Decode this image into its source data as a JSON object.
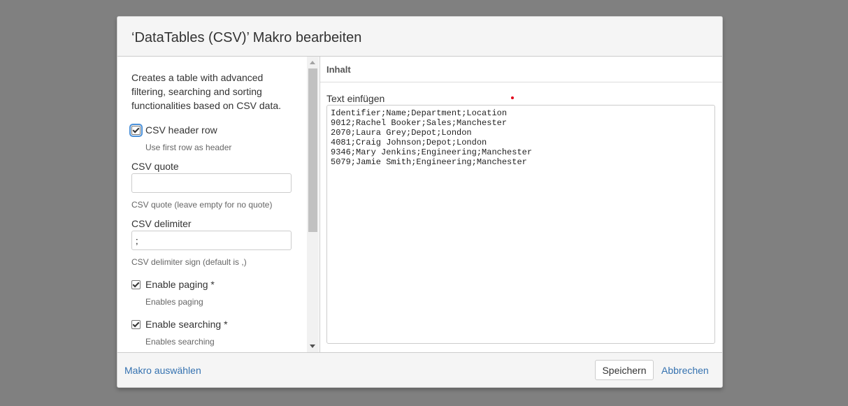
{
  "dialog": {
    "title": "‘DataTables (CSV)’ Makro bearbeiten"
  },
  "left": {
    "description": "Creates a table with advanced filtering, searching and sorting functionalities based on CSV data.",
    "csv_header": {
      "label": "CSV header row",
      "hint": "Use first row as header",
      "checked": true
    },
    "csv_quote": {
      "label": "CSV quote",
      "value": "",
      "hint": "CSV quote (leave empty for no quote)"
    },
    "csv_delimiter": {
      "label": "CSV delimiter",
      "value": ";",
      "hint": "CSV delimiter sign (default is ,)"
    },
    "paging": {
      "label": "Enable paging *",
      "hint": "Enables paging",
      "checked": true
    },
    "searching": {
      "label": "Enable searching *",
      "hint": "Enables searching",
      "checked": true
    }
  },
  "right": {
    "section_title": "Inhalt",
    "paste_label": "Text einfügen",
    "csv_text": "Identifier;Name;Department;Location\n9012;Rachel Booker;Sales;Manchester\n2070;Laura Grey;Depot;London\n4081;Craig Johnson;Depot;London\n9346;Mary Jenkins;Engineering;Manchester\n5079;Jamie Smith;Engineering;Manchester"
  },
  "footer": {
    "select_macro": "Makro auswählen",
    "save": "Speichern",
    "cancel": "Abbrechen"
  },
  "colors": {
    "overlay": "#808080",
    "link": "#3572b0",
    "required": "#e2001a"
  }
}
